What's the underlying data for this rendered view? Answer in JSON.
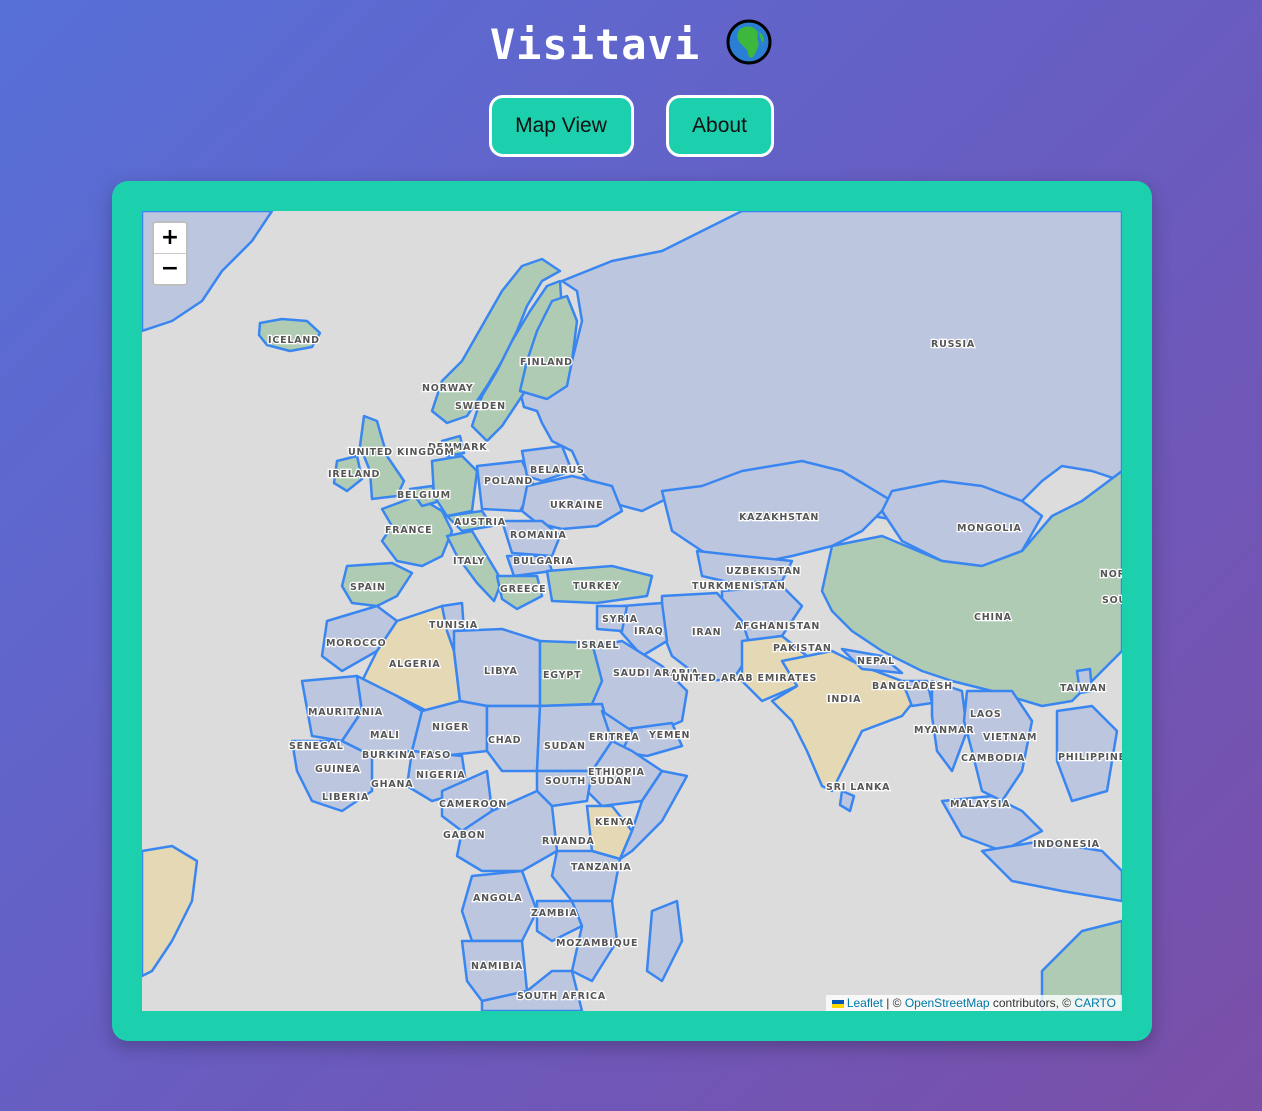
{
  "header": {
    "title": "Visitavi",
    "globe_icon": "globe-africa-icon"
  },
  "nav": {
    "map_view": "Map View",
    "about": "About"
  },
  "colors": {
    "background_start": "#5670d8",
    "background_end": "#7a4fa8",
    "accent": "#1ccfad",
    "water": "#dcdcdc",
    "border": "#3a86f0",
    "status_visited": "#b0cbb3",
    "status_wishlist": "#e5d8b5",
    "status_unvisited": "#bcc6df"
  },
  "map": {
    "zoom_in": "+",
    "zoom_out": "−",
    "attribution": {
      "leaflet": "Leaflet",
      "sep1": " | © ",
      "osm": "OpenStreetMap",
      "contrib": " contributors, © ",
      "carto": "CARTO"
    },
    "countries": [
      {
        "name": "ICELAND",
        "status": "visited"
      },
      {
        "name": "NORWAY",
        "status": "visited"
      },
      {
        "name": "SWEDEN",
        "status": "visited"
      },
      {
        "name": "FINLAND",
        "status": "visited"
      },
      {
        "name": "RUSSIA",
        "status": "unvisited"
      },
      {
        "name": "DENMARK",
        "status": "visited"
      },
      {
        "name": "UNITED KINGDOM",
        "status": "visited"
      },
      {
        "name": "IRELAND",
        "status": "visited"
      },
      {
        "name": "BELARUS",
        "status": "unvisited"
      },
      {
        "name": "POLAND",
        "status": "unvisited"
      },
      {
        "name": "BELGIUM",
        "status": "visited"
      },
      {
        "name": "UKRAINE",
        "status": "unvisited"
      },
      {
        "name": "FRANCE",
        "status": "visited"
      },
      {
        "name": "AUSTRIA",
        "status": "visited"
      },
      {
        "name": "ROMANIA",
        "status": "unvisited"
      },
      {
        "name": "ITALY",
        "status": "visited"
      },
      {
        "name": "BULGARIA",
        "status": "unvisited"
      },
      {
        "name": "SPAIN",
        "status": "visited"
      },
      {
        "name": "GREECE",
        "status": "visited"
      },
      {
        "name": "TURKEY",
        "status": "visited"
      },
      {
        "name": "KAZAKHSTAN",
        "status": "unvisited"
      },
      {
        "name": "MONGOLIA",
        "status": "unvisited"
      },
      {
        "name": "UZBEKISTAN",
        "status": "unvisited"
      },
      {
        "name": "TURKMENISTAN",
        "status": "unvisited"
      },
      {
        "name": "CHINA",
        "status": "visited"
      },
      {
        "name": "NORTH KOREA",
        "status": "unvisited"
      },
      {
        "name": "SOUTH KOREA",
        "status": "unvisited"
      },
      {
        "name": "TUNISIA",
        "status": "unvisited"
      },
      {
        "name": "SYRIA",
        "status": "unvisited"
      },
      {
        "name": "IRAQ",
        "status": "unvisited"
      },
      {
        "name": "IRAN",
        "status": "unvisited"
      },
      {
        "name": "AFGHANISTAN",
        "status": "unvisited"
      },
      {
        "name": "MOROCCO",
        "status": "unvisited"
      },
      {
        "name": "ISRAEL",
        "status": "unvisited"
      },
      {
        "name": "PAKISTAN",
        "status": "wishlist"
      },
      {
        "name": "ALGERIA",
        "status": "wishlist"
      },
      {
        "name": "LIBYA",
        "status": "unvisited"
      },
      {
        "name": "EGYPT",
        "status": "visited"
      },
      {
        "name": "SAUDI ARABIA",
        "status": "unvisited"
      },
      {
        "name": "NEPAL",
        "status": "unvisited"
      },
      {
        "name": "UNITED ARAB EMIRATES",
        "status": "unvisited"
      },
      {
        "name": "BANGLADESH",
        "status": "unvisited"
      },
      {
        "name": "TAIWAN",
        "status": "unvisited"
      },
      {
        "name": "INDIA",
        "status": "wishlist"
      },
      {
        "name": "MAURITANIA",
        "status": "unvisited"
      },
      {
        "name": "LAOS",
        "status": "unvisited"
      },
      {
        "name": "NIGER",
        "status": "unvisited"
      },
      {
        "name": "MYANMAR",
        "status": "unvisited"
      },
      {
        "name": "MALI",
        "status": "unvisited"
      },
      {
        "name": "CHAD",
        "status": "unvisited"
      },
      {
        "name": "ERITREA",
        "status": "unvisited"
      },
      {
        "name": "YEMEN",
        "status": "unvisited"
      },
      {
        "name": "VIETNAM",
        "status": "unvisited"
      },
      {
        "name": "SENEGAL",
        "status": "unvisited"
      },
      {
        "name": "SUDAN",
        "status": "unvisited"
      },
      {
        "name": "BURKINA FASO",
        "status": "unvisited"
      },
      {
        "name": "CAMBODIA",
        "status": "unvisited"
      },
      {
        "name": "PHILIPPINES",
        "status": "unvisited"
      },
      {
        "name": "GUINEA",
        "status": "unvisited"
      },
      {
        "name": "NIGERIA",
        "status": "unvisited"
      },
      {
        "name": "ETHIOPIA",
        "status": "unvisited"
      },
      {
        "name": "GHANA",
        "status": "unvisited"
      },
      {
        "name": "SOUTH SUDAN",
        "status": "unvisited"
      },
      {
        "name": "SRI LANKA",
        "status": "unvisited"
      },
      {
        "name": "LIBERIA",
        "status": "unvisited"
      },
      {
        "name": "CAMEROON",
        "status": "unvisited"
      },
      {
        "name": "MALAYSIA",
        "status": "unvisited"
      },
      {
        "name": "KENYA",
        "status": "wishlist"
      },
      {
        "name": "GABON",
        "status": "unvisited"
      },
      {
        "name": "RWANDA",
        "status": "unvisited"
      },
      {
        "name": "INDONESIA",
        "status": "unvisited"
      },
      {
        "name": "TANZANIA",
        "status": "unvisited"
      },
      {
        "name": "ANGOLA",
        "status": "unvisited"
      },
      {
        "name": "ZAMBIA",
        "status": "unvisited"
      },
      {
        "name": "MOZAMBIQUE",
        "status": "unvisited"
      },
      {
        "name": "NAMIBIA",
        "status": "unvisited"
      },
      {
        "name": "SOUTH AFRICA",
        "status": "unvisited"
      }
    ]
  }
}
